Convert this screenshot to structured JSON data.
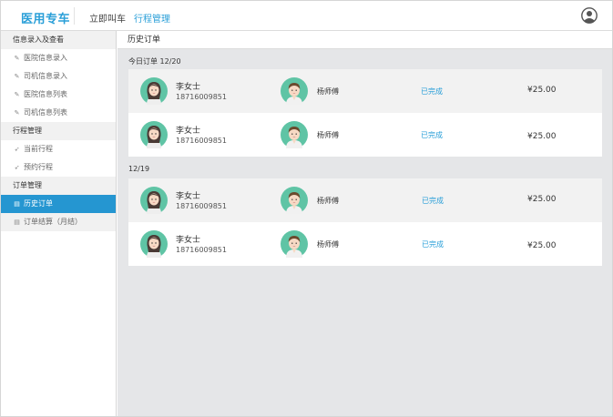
{
  "colors": {
    "accent": "#2a9fd8",
    "sidebar_active": "#2596d1",
    "main_bg": "#e5e6e8",
    "avatar_bg": "#5fc4a5"
  },
  "topbar": {
    "brand": "医用专车",
    "nav": [
      "立即叫车",
      "行程管理"
    ],
    "active_nav": "行程管理",
    "user_icon": "user-circle-icon"
  },
  "sidebar": {
    "groups": [
      {
        "label": "信息录入及查看",
        "items": [
          {
            "label": "医院信息录入",
            "icon": "edit-icon"
          },
          {
            "label": "司机信息录入",
            "icon": "edit-icon"
          },
          {
            "label": "医院信息列表",
            "icon": "edit-icon"
          },
          {
            "label": "司机信息列表",
            "icon": "edit-icon"
          }
        ]
      },
      {
        "label": "行程管理",
        "items": [
          {
            "label": "当前行程",
            "icon": "send-icon"
          },
          {
            "label": "预约行程",
            "icon": "send-icon"
          }
        ]
      },
      {
        "label": "订单管理",
        "items": [
          {
            "label": "历史订单",
            "icon": "document-icon",
            "active": true
          },
          {
            "label": "订单结算（月结）",
            "icon": "document-icon"
          }
        ]
      }
    ]
  },
  "main": {
    "page_title": "历史订单",
    "sections": [
      {
        "label": "今日订单  12/20",
        "orders": [
          {
            "passenger": "李女士",
            "phone": "18716009851",
            "driver": "杨师傅",
            "status": "已完成",
            "price": "¥25.00"
          },
          {
            "passenger": "李女士",
            "phone": "18716009851",
            "driver": "杨师傅",
            "status": "已完成",
            "price": "¥25.00"
          }
        ]
      },
      {
        "label": "12/19",
        "orders": [
          {
            "passenger": "李女士",
            "phone": "18716009851",
            "driver": "杨师傅",
            "status": "已完成",
            "price": "¥25.00"
          },
          {
            "passenger": "李女士",
            "phone": "18716009851",
            "driver": "杨师傅",
            "status": "已完成",
            "price": "¥25.00"
          }
        ]
      }
    ]
  }
}
